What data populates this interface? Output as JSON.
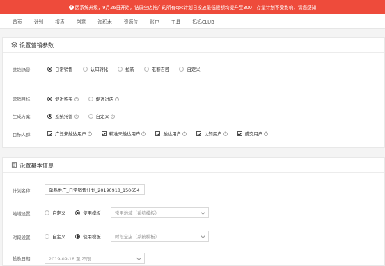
{
  "banner": {
    "icon": "info-icon",
    "text": "因系统升级，9月26日开始，钻展全店推广的所有cpc计划日投放最低限额均提升至300，存量计划不受影响，请您感知"
  },
  "nav": [
    "首页",
    "计划",
    "报表",
    "创意",
    "淘积木",
    "资源位",
    "账户",
    "工具",
    "妈妈CLUB"
  ],
  "section1": {
    "title": "设置营销参数",
    "scene": {
      "label": "营销场景",
      "options": [
        "日常销售",
        "认知转化",
        "拉新",
        "老客召回",
        "自定义"
      ]
    },
    "goal": {
      "label": "营销目标",
      "options": [
        "促进购买",
        "促进进店"
      ]
    },
    "plan": {
      "label": "生成方案",
      "options": [
        "系统托管",
        "自定义"
      ]
    },
    "audience": {
      "label": "目标人群",
      "options": [
        "广泛未触达用户",
        "精准未触达用户",
        "触达用户",
        "认知用户",
        "成交用户"
      ]
    }
  },
  "section2": {
    "title": "设置基本信息",
    "name": {
      "label": "计划名称",
      "value": "单品推广_日常销售计划_20190918_150654"
    },
    "region": {
      "label": "地域设置",
      "options": [
        "自定义",
        "使用模板"
      ],
      "select": "常用地域（系统模板）"
    },
    "time": {
      "label": "时段设置",
      "options": [
        "自定义",
        "使用模板"
      ],
      "select": "时段全店（系统模板）"
    },
    "date": {
      "label": "投放日期",
      "value": "2019-09-18 至 不限"
    }
  }
}
